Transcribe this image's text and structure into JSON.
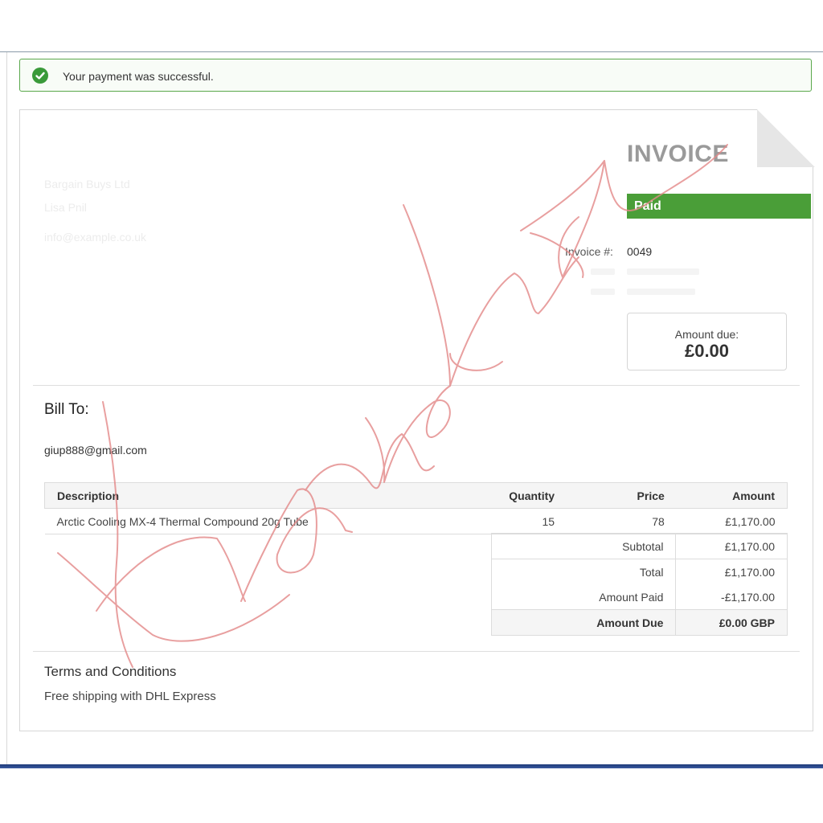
{
  "alert": {
    "message": "Your payment was successful.",
    "icon": "check-circle-icon",
    "color": "#3a9a3a"
  },
  "invoice": {
    "title": "INVOICE",
    "status": "Paid",
    "status_color": "#4a9e38",
    "number_label": "Invoice #:",
    "number": "0049",
    "amount_due_label": "Amount due:",
    "amount_due": "£0.00"
  },
  "seller": {
    "lines": [
      "Bargain Buys Ltd",
      "Lisa Pnil",
      "info@example.co.uk"
    ]
  },
  "bill_to": {
    "heading": "Bill To:",
    "email": "giup888@gmail.com"
  },
  "items": {
    "headers": {
      "description": "Description",
      "quantity": "Quantity",
      "price": "Price",
      "amount": "Amount"
    },
    "rows": [
      {
        "description": "Arctic Cooling MX-4 Thermal Compound 20g Tube",
        "quantity": "15",
        "price": "78",
        "amount": "£1,170.00"
      }
    ]
  },
  "totals": {
    "subtotal_label": "Subtotal",
    "subtotal": "£1,170.00",
    "total_label": "Total",
    "total": "£1,170.00",
    "paid_label": "Amount Paid",
    "paid": "-£1,170.00",
    "due_label": "Amount Due",
    "due": "£0.00 GBP"
  },
  "terms": {
    "heading": "Terms and Conditions",
    "text": "Free shipping with DHL Express"
  }
}
